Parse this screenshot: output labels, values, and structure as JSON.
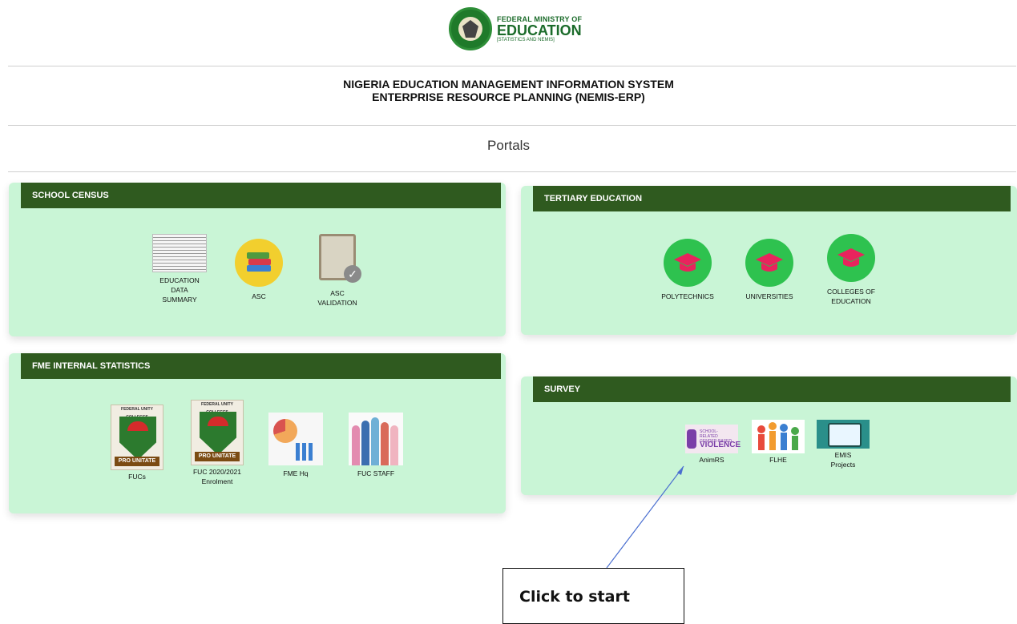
{
  "logo": {
    "line1": "FEDERAL MINISTRY OF",
    "line2": "EDUCATION",
    "line3": "[STATISTICS AND NEMIS]"
  },
  "title": {
    "line1": "NIGERIA EDUCATION MANAGEMENT INFORMATION SYSTEM",
    "line2": "ENTERPRISE RESOURCE PLANNING (NEMIS-ERP)"
  },
  "portals_label": "Portals",
  "school_census": {
    "header": "SCHOOL CENSUS",
    "tiles": [
      {
        "label1": "EDUCATION",
        "label2": "DATA",
        "label3": "SUMMARY"
      },
      {
        "label1": "ASC"
      },
      {
        "label1": "ASC",
        "label2": "VALIDATION"
      }
    ]
  },
  "tertiary": {
    "header": "TERTIARY EDUCATION",
    "tiles": [
      {
        "label1": "POLYTECHNICS"
      },
      {
        "label1": "UNIVERSITIES"
      },
      {
        "label1": "COLLEGES OF",
        "label2": "EDUCATION"
      }
    ]
  },
  "fme": {
    "header": "FME INTERNAL STATISTICS",
    "crest_top": "FEDERAL UNITY COLLEGES",
    "crest_motto": "PRO UNITATE",
    "tiles": [
      {
        "label1": "FUCs"
      },
      {
        "label1": "FUC 2020/2021",
        "label2": "Enrolment"
      },
      {
        "label1": "FME Hq"
      },
      {
        "label1": "FUC STAFF"
      }
    ]
  },
  "survey": {
    "header": "SURVEY",
    "violence_text": "VIOLENCE",
    "violence_sub": "SCHOOL-RELATED GENDER-BASED",
    "tiles": [
      {
        "label1": "AnimRS"
      },
      {
        "label1": "FLHE"
      },
      {
        "label1": "EMIS",
        "label2": "Projects"
      }
    ]
  },
  "annotation": {
    "text": "Click to start"
  },
  "colors": {
    "header_green": "#2f5a1f",
    "card_bg": "#c9f5d6",
    "icon_green": "#2ec24f",
    "icon_yellow": "#f2cf2e",
    "cap_pink": "#e8245d"
  }
}
